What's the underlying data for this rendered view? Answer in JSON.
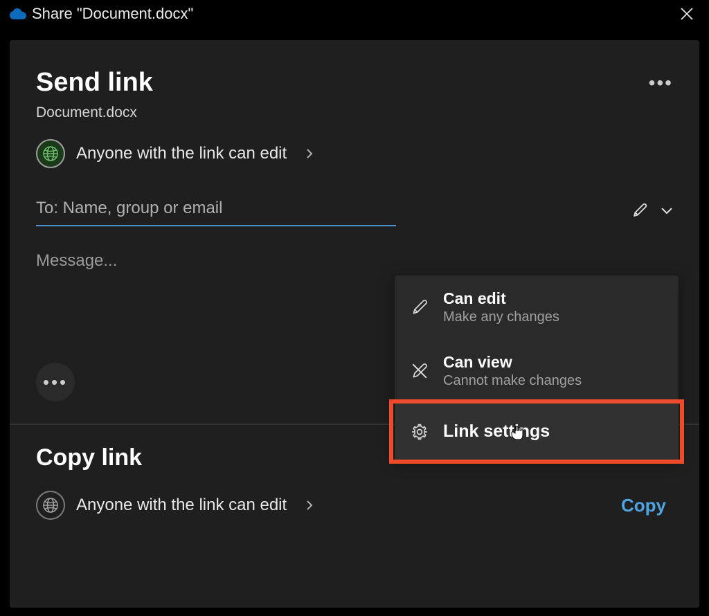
{
  "titlebar": {
    "title": "Share \"Document.docx\""
  },
  "dialog": {
    "heading": "Send link",
    "filename": "Document.docx",
    "permission_text": "Anyone with the link can edit",
    "to_placeholder": "To: Name, group or email",
    "message_placeholder": "Message..."
  },
  "dropdown": {
    "items": [
      {
        "label": "Can edit",
        "description": "Make any changes",
        "icon": "pencil-icon"
      },
      {
        "label": "Can view",
        "description": "Cannot make changes",
        "icon": "pencil-slash-icon"
      }
    ],
    "link_settings_label": "Link settings"
  },
  "copy_section": {
    "heading": "Copy link",
    "permission_text": "Anyone with the link can edit",
    "copy_button": "Copy"
  }
}
